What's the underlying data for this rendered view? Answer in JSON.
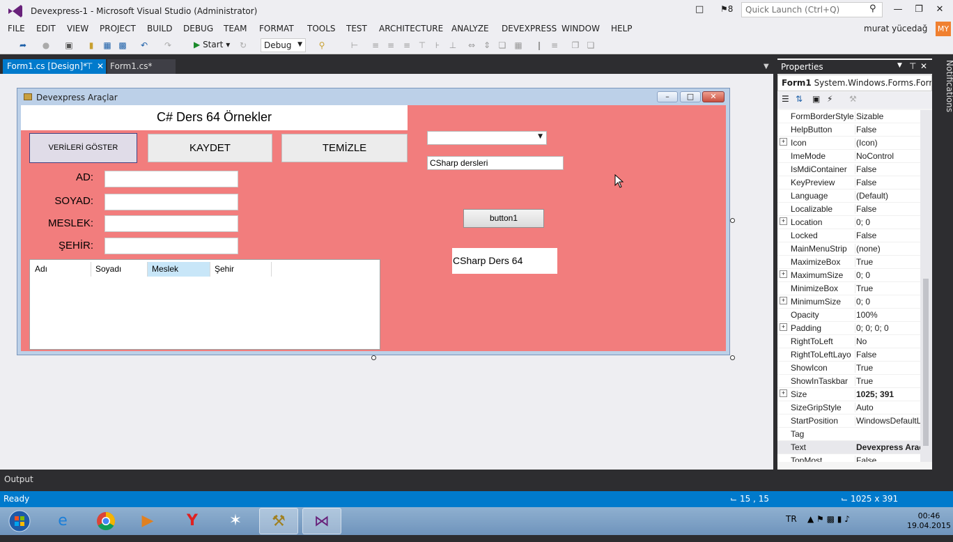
{
  "titlebar": {
    "title": "Devexpress-1 - Microsoft Visual Studio (Administrator)",
    "notification_count": "8",
    "quick_launch_placeholder": "Quick Launch (Ctrl+Q)"
  },
  "menu": [
    "FILE",
    "EDIT",
    "VIEW",
    "PROJECT",
    "BUILD",
    "DEBUG",
    "TEAM",
    "FORMAT",
    "TOOLS",
    "TEST",
    "ARCHITECTURE",
    "ANALYZE",
    "DEVEXPRESS",
    "WINDOW",
    "HELP"
  ],
  "user": {
    "name": "murat yücedağ",
    "initials": "MY"
  },
  "toolbar": {
    "start_label": "Start",
    "config": "Debug"
  },
  "tabs": [
    {
      "label": "Form1.cs [Design]*",
      "active": true
    },
    {
      "label": "Form1.cs*",
      "active": false
    }
  ],
  "form": {
    "title": "Devexpress Araçlar",
    "header": "C# Ders 64 Örnekler",
    "buttons": {
      "show": "VERİLERİ GÖSTER",
      "save": "KAYDET",
      "clear": "TEMİZLE",
      "button1": "button1"
    },
    "fields": [
      {
        "label": "AD:",
        "value": ""
      },
      {
        "label": "SOYAD:",
        "value": ""
      },
      {
        "label": "MESLEK:",
        "value": ""
      },
      {
        "label": "ŞEHİR:",
        "value": ""
      }
    ],
    "grid_columns": [
      "Adı",
      "Soyadı",
      "Meslek",
      "Şehir"
    ],
    "combo_value": "",
    "textbox_value": "CSharp dersleri",
    "label_text": "CSharp Ders 64"
  },
  "properties": {
    "title": "Properties",
    "object": "Form1",
    "object_type": "System.Windows.Forms.Form",
    "rows": [
      {
        "name": "FormBorderStyle",
        "value": "Sizable",
        "exp": false
      },
      {
        "name": "HelpButton",
        "value": "False",
        "exp": false
      },
      {
        "name": "Icon",
        "value": "(Icon)",
        "exp": true
      },
      {
        "name": "ImeMode",
        "value": "NoControl",
        "exp": false
      },
      {
        "name": "IsMdiContainer",
        "value": "False",
        "exp": false
      },
      {
        "name": "KeyPreview",
        "value": "False",
        "exp": false
      },
      {
        "name": "Language",
        "value": "(Default)",
        "exp": false
      },
      {
        "name": "Localizable",
        "value": "False",
        "exp": false
      },
      {
        "name": "Location",
        "value": "0; 0",
        "exp": true
      },
      {
        "name": "Locked",
        "value": "False",
        "exp": false
      },
      {
        "name": "MainMenuStrip",
        "value": "(none)",
        "exp": false
      },
      {
        "name": "MaximizeBox",
        "value": "True",
        "exp": false
      },
      {
        "name": "MaximumSize",
        "value": "0; 0",
        "exp": true
      },
      {
        "name": "MinimizeBox",
        "value": "True",
        "exp": false
      },
      {
        "name": "MinimumSize",
        "value": "0; 0",
        "exp": true
      },
      {
        "name": "Opacity",
        "value": "100%",
        "exp": false
      },
      {
        "name": "Padding",
        "value": "0; 0; 0; 0",
        "exp": true
      },
      {
        "name": "RightToLeft",
        "value": "No",
        "exp": false
      },
      {
        "name": "RightToLeftLayo",
        "value": "False",
        "exp": false
      },
      {
        "name": "ShowIcon",
        "value": "True",
        "exp": false
      },
      {
        "name": "ShowInTaskbar",
        "value": "True",
        "exp": false
      },
      {
        "name": "Size",
        "value": "1025; 391",
        "exp": true,
        "bold": true
      },
      {
        "name": "SizeGripStyle",
        "value": "Auto",
        "exp": false
      },
      {
        "name": "StartPosition",
        "value": "WindowsDefaultL",
        "exp": false
      },
      {
        "name": "Tag",
        "value": "",
        "exp": false
      },
      {
        "name": "Text",
        "value": "Devexpress Araç",
        "exp": false,
        "bold": true,
        "selected": true
      },
      {
        "name": "TopMost",
        "value": "False",
        "exp": false
      }
    ]
  },
  "notifications_label": "Notifications",
  "output_label": "Output",
  "status": {
    "text": "Ready",
    "position": "15 , 15",
    "size": "1025 x 391"
  },
  "taskbar": {
    "language": "TR",
    "time": "00:46",
    "date": "19.04.2015"
  },
  "colors": {
    "accent": "#007acc",
    "form_back": "#f27d7d"
  }
}
